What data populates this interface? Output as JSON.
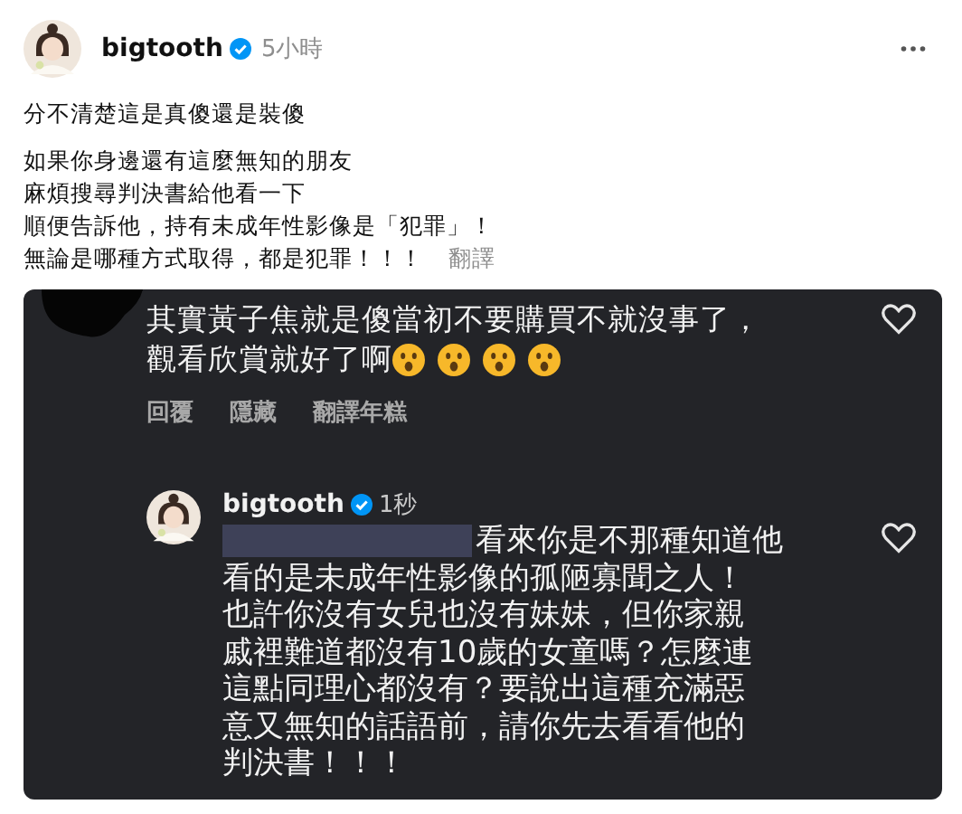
{
  "post": {
    "author": "bigtooth",
    "verified": true,
    "time": "5小時",
    "paragraphs": [
      [
        "分不清楚這是真傻還是裝傻"
      ],
      [
        "如果你身邊還有這麼無知的朋友",
        "麻煩搜尋判決書給他看一下",
        "順便告訴他，持有未成年性影像是「犯罪」！",
        "無論是哪種方式取得，都是犯罪！！！"
      ]
    ],
    "translate": "翻譯"
  },
  "screenshot": {
    "comment": {
      "lines": [
        "其實黃子焦就是傻當初不要購買不就沒事了，",
        "觀看欣賞就好了啊"
      ],
      "emojis": [
        {
          "kind": "surprised"
        },
        {
          "kind": "surprised"
        },
        {
          "kind": "surprised"
        },
        {
          "kind": "surprised"
        }
      ],
      "liked": false,
      "actions": [
        "回覆",
        "隱藏",
        "翻譯年糕"
      ]
    },
    "reply": {
      "author": "bigtooth",
      "verified": true,
      "time": "1秒",
      "liked": false,
      "lines": [
        "看來你是不那種知道他",
        "看的是未成年性影像的孤陋寡聞之人！",
        "也許你沒有女兒也沒有妹妹，但你家親",
        "戚裡難道都沒有10歲的女童嗎？怎麼連",
        "這點同理心都沒有？要說出這種充滿惡",
        "意又無知的話語前，請你先去看看他的",
        "判決書！！！"
      ]
    }
  }
}
